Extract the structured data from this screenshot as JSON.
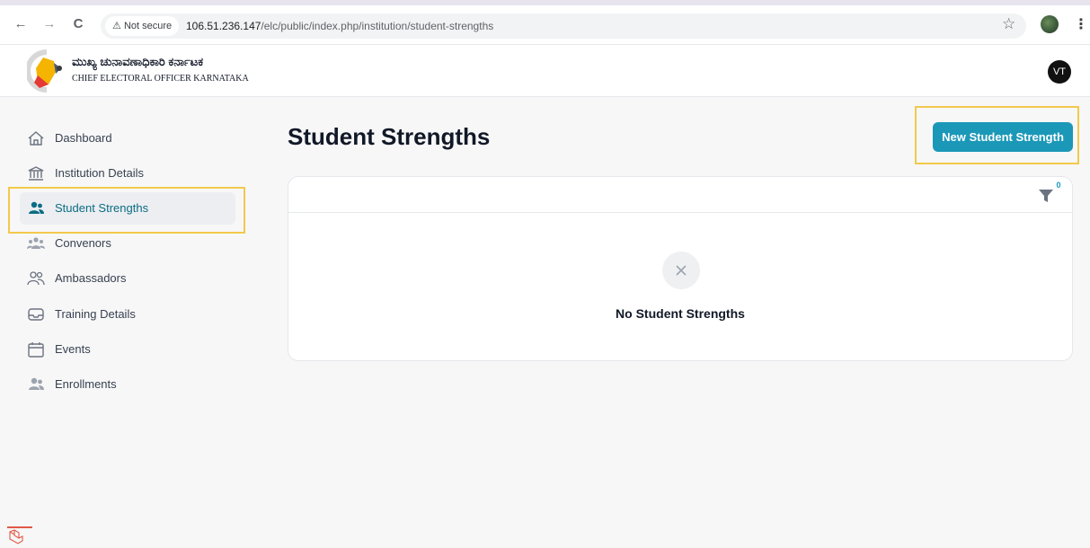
{
  "browser": {
    "back_icon": "arrow-left-icon",
    "forward_icon": "arrow-right-icon",
    "reload_icon": "reload-icon",
    "security_label": "Not secure",
    "url_host": "106.51.236.147",
    "url_path": "/elc/public/index.php/institution/student-strengths",
    "bookmark_icon": "star-icon",
    "menu_icon": "kebab-icon"
  },
  "header": {
    "logo_title_kannada": "ಮುಖ್ಯ ಚುನಾವಣಾಧಿಕಾರಿ ಕರ್ನಾಟಕ",
    "logo_title_english": "CHIEF ELECTORAL OFFICER KARNATAKA",
    "user_initials": "VT"
  },
  "sidebar": {
    "items": [
      {
        "label": "Dashboard",
        "icon": "home-icon",
        "active": false
      },
      {
        "label": "Institution Details",
        "icon": "bank-icon",
        "active": false
      },
      {
        "label": "Student Strengths",
        "icon": "users-icon",
        "active": true
      },
      {
        "label": "Convenors",
        "icon": "user-group-icon",
        "active": false
      },
      {
        "label": "Ambassadors",
        "icon": "user-pair-icon",
        "active": false
      },
      {
        "label": "Training Details",
        "icon": "tray-icon",
        "active": false
      },
      {
        "label": "Events",
        "icon": "calendar-icon",
        "active": false
      },
      {
        "label": "Enrollments",
        "icon": "users-icon",
        "active": false
      }
    ]
  },
  "main": {
    "title": "Student Strengths",
    "new_button_label": "New Student Strength",
    "filter_count": "0",
    "empty_state_text": "No Student Strengths"
  },
  "colors": {
    "accent": "#1b98b8",
    "highlight": "#f2c94c"
  }
}
